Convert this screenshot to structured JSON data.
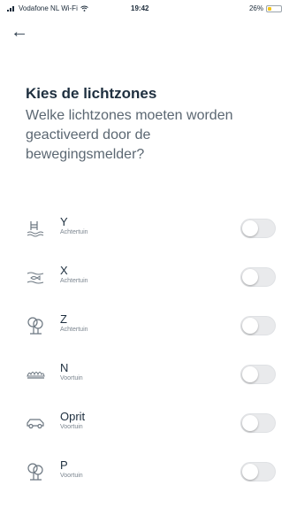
{
  "status_bar": {
    "carrier": "Vodafone NL Wi-Fi",
    "time": "19:42",
    "battery": "26%",
    "battery_level": 0.26,
    "battery_color": "#f5c518"
  },
  "header": {
    "back_icon": "back-arrow-icon",
    "title": "Kies de lichtzones",
    "subtitle": "Welke lichtzones moeten worden geactiveerd door de bewegingsmelder?"
  },
  "zones": [
    {
      "name": "Y",
      "area": "Achtertuin",
      "icon": "pool-icon",
      "enabled": false
    },
    {
      "name": "X",
      "area": "Achtertuin",
      "icon": "pond-icon",
      "enabled": false
    },
    {
      "name": "Z",
      "area": "Achtertuin",
      "icon": "tree-icon",
      "enabled": false
    },
    {
      "name": "N",
      "area": "Voortuin",
      "icon": "hedge-icon",
      "enabled": false
    },
    {
      "name": "Oprit",
      "area": "Voortuin",
      "icon": "car-icon",
      "enabled": false
    },
    {
      "name": "P",
      "area": "Voortuin",
      "icon": "tree-icon",
      "enabled": false
    }
  ]
}
